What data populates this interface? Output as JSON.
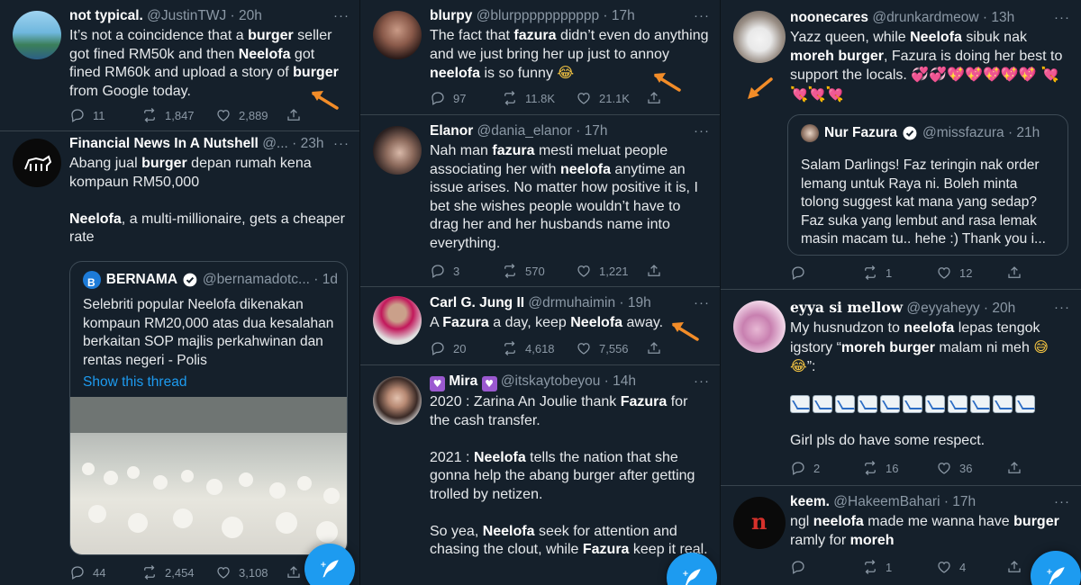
{
  "colors": {
    "background": "#15202b",
    "accent": "#1d9bf0",
    "border": "#38444d",
    "secondary_text": "#8b98a5",
    "arrow": "#f28c28"
  },
  "col1": {
    "t1": {
      "name": "not typical.",
      "handle": "@JustinTWJ · 20h",
      "replies": "11",
      "retweets": "1,847",
      "likes": "2,889"
    },
    "t2": {
      "name": "Financial News In A Nutshell",
      "handle": "@... · 23h",
      "replies": "44",
      "retweets": "2,454",
      "likes": "3,108",
      "quote": {
        "name": "BERNAMA",
        "handle": "@bernamadotc... · 1d",
        "text": "Selebriti popular Neelofa dikenakan kompaun RM20,000 atas dua kesalahan berkaitan SOP majlis perkahwinan dan rentas negeri - Polis",
        "show_thread": "Show this thread"
      }
    }
  },
  "col2": {
    "t1": {
      "name": "blurpy",
      "handle": "@blurppppppppppp · 17h",
      "replies": "97",
      "retweets": "11.8K",
      "likes": "21.1K"
    },
    "t2": {
      "name": "Elanor",
      "handle": "@dania_elanor · 17h",
      "replies": "3",
      "retweets": "570",
      "likes": "1,221"
    },
    "t3": {
      "name": "Carl G. Jung II",
      "handle": "@drmuhaimin · 19h",
      "replies": "20",
      "retweets": "4,618",
      "likes": "7,556"
    },
    "t4": {
      "name": "Mira",
      "handle": "@itskaytobeyou · 14h"
    }
  },
  "col3": {
    "t1": {
      "name": "noonecares",
      "handle": "@drunkardmeow · 13h",
      "replies": "",
      "retweets": "1",
      "likes": "12",
      "quote": {
        "name": "Nur Fazura",
        "handle": "@missfazura · 21h",
        "text": "Salam Darlings! Faz teringin nak order lemang untuk Raya ni. Boleh minta tolong suggest kat mana yang sedap? Faz suka yang lembut and rasa lemak masin macam tu.. hehe :) Thank you i..."
      }
    },
    "t2": {
      "name": "eyya si mellow",
      "handle": "@eyyaheyy · 20h",
      "replies": "2",
      "retweets": "16",
      "likes": "36"
    },
    "t3": {
      "name": "keem.",
      "handle": "@HakeemBahari · 17h",
      "replies": "",
      "retweets": "1",
      "likes": "4"
    }
  },
  "icons": [
    "reply-icon",
    "retweet-icon",
    "like-icon",
    "share-icon",
    "compose-icon",
    "verified-icon",
    "more-icon"
  ]
}
